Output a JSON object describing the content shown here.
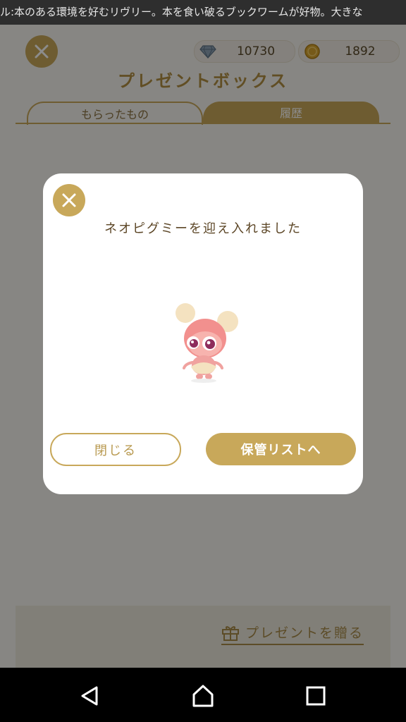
{
  "ticker": {
    "text": "ル:本のある環境を好むリヴリー。本を食い破るブックワームが好物。大きな"
  },
  "header": {
    "diamonds": "10730",
    "coins": "1892",
    "title": "プレゼントボックス"
  },
  "tabs": [
    {
      "label": "もらったもの"
    },
    {
      "label": "履歴"
    }
  ],
  "footer": {
    "send_label": "プレゼントを贈る"
  },
  "modal": {
    "message": "ネオピグミーを迎え入れました",
    "close_label": "閉じる",
    "storage_label": "保管リストへ"
  },
  "colors": {
    "accent": "#c8a85a",
    "text_brown": "#5c4626"
  },
  "icons": {
    "diamond": "diamond-icon",
    "coin": "coin-icon",
    "gift": "gift-icon",
    "close": "close-icon",
    "back": "back-icon",
    "home": "home-icon",
    "recents": "recents-icon"
  }
}
